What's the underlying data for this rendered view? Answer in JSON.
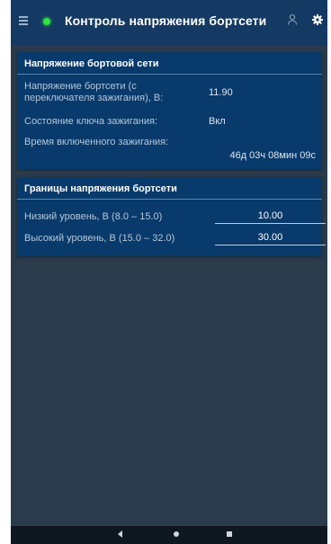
{
  "header": {
    "title": "Контроль напряжения бортсети",
    "menu_icon": "hamburger-menu-icon",
    "status_color": "#2ee63a"
  },
  "voltage_card": {
    "title": "Напряжение бортовой сети",
    "voltage_label": "Напряжение бортсети (с переключателя зажигания), В:",
    "voltage_value": "11.90",
    "ignition_label": "Состояние ключа зажигания:",
    "ignition_value": "Вкл",
    "ignition_time_label": "Время включенного зажигания:",
    "ignition_time_value": "46д 03ч 08мин 09с"
  },
  "limits_card": {
    "title": "Границы напряжения бортсети",
    "low_label": "Низкий уровень, В (8.0 – 15.0)",
    "low_value": "10.00",
    "high_label": "Высокий уровень, В (15.0 – 32.0)",
    "high_value": "30.00"
  },
  "colors": {
    "appbar": "#143a63",
    "card": "#083a6b",
    "background": "#2a3b4b"
  }
}
